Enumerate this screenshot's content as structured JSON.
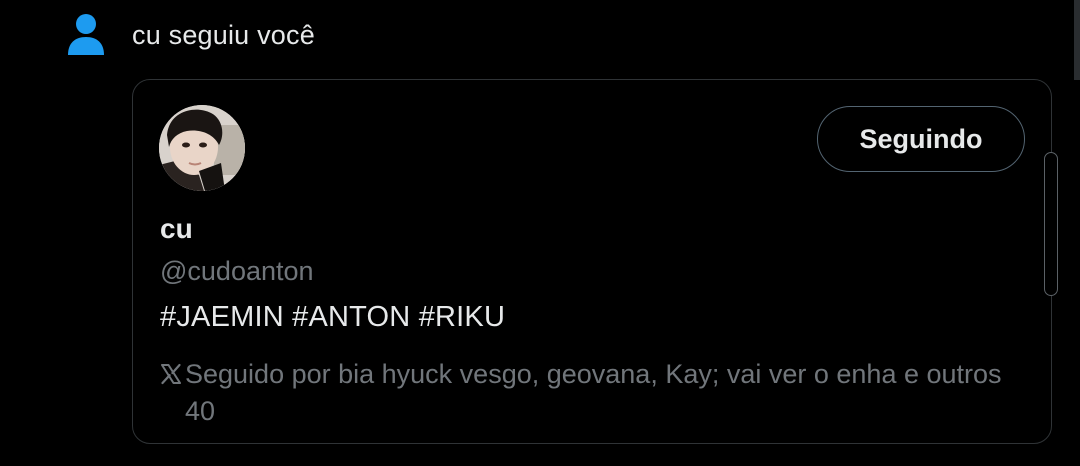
{
  "notification": {
    "icon": "person-icon",
    "icon_color": "#1d9bf0",
    "text": "cu seguiu você"
  },
  "card": {
    "avatar_icon": "profile-photo",
    "follow_button_label": "Seguindo",
    "display_name": "cu",
    "handle": "@cudoanton",
    "bio": "#JAEMIN #ANTON #RIKU",
    "followed_by_icon": "x-logo-icon",
    "followed_by_text": "Seguido por bia hyuck vesgo, geovana, Kay; vai ver o enha e outros 40"
  },
  "colors": {
    "background": "#000000",
    "text_primary": "#e7e9ea",
    "text_secondary": "#71767b",
    "border": "#2f3336",
    "accent": "#1d9bf0"
  }
}
